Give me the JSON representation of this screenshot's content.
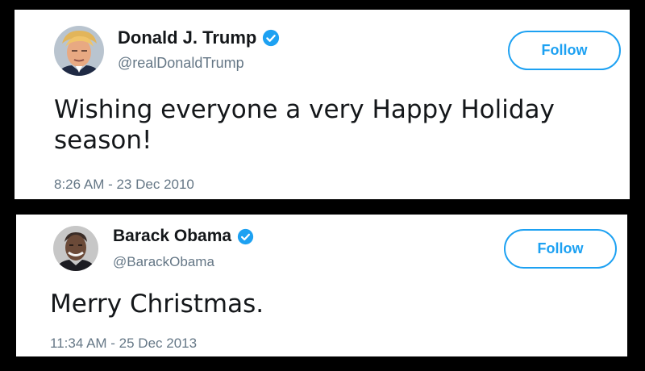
{
  "tweets": [
    {
      "display_name": "Donald J. Trump",
      "handle": "@realDonaldTrump",
      "verified": true,
      "follow_label": "Follow",
      "text": "Wishing everyone a very Happy Holiday season!",
      "timestamp": "8:26 AM - 23 Dec 2010",
      "avatar_icon": "avatar-portrait"
    },
    {
      "display_name": "Barack Obama",
      "handle": "@BarackObama",
      "verified": true,
      "follow_label": "Follow",
      "text": "Merry Christmas.",
      "timestamp": "11:34 AM - 25 Dec 2013",
      "avatar_icon": "avatar-portrait"
    }
  ],
  "colors": {
    "background": "#000000",
    "card": "#ffffff",
    "accent": "#1da1f2",
    "text_primary": "#14171a",
    "text_secondary": "#657786"
  }
}
